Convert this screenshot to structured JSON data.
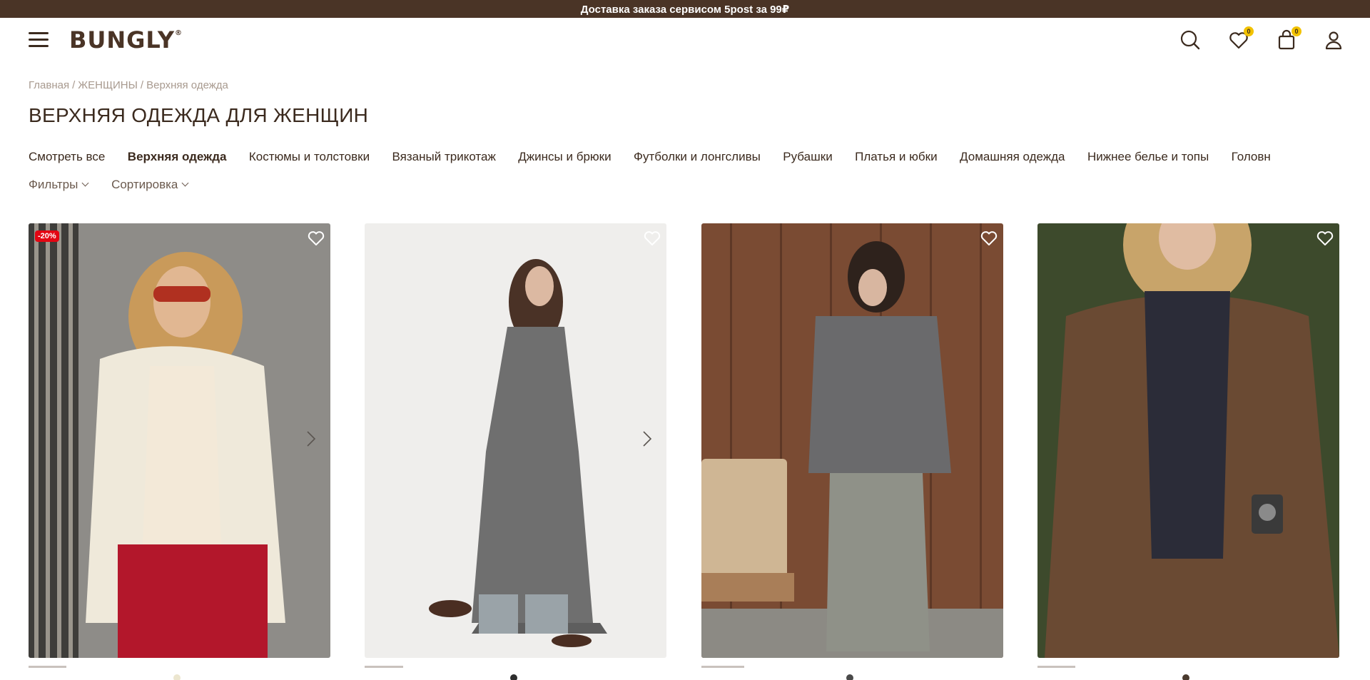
{
  "promo": {
    "text": "Доставка заказа сервисом 5post за 99₽"
  },
  "header": {
    "logo": "BUNGLY",
    "logo_mark": "®",
    "wishlist_count": "0",
    "cart_count": "0",
    "icons": [
      "menu-icon",
      "search-icon",
      "heart-icon",
      "bag-icon",
      "user-icon"
    ]
  },
  "breadcrumb": {
    "items": [
      "Главная",
      "ЖЕНЩИНЫ",
      "Верхняя одежда"
    ],
    "separator": "/"
  },
  "page_title": "ВЕРХНЯЯ ОДЕЖДА ДЛЯ ЖЕНЩИН",
  "categories": [
    {
      "label": "Смотреть все",
      "active": false
    },
    {
      "label": "Верхняя одежда",
      "active": true
    },
    {
      "label": "Костюмы и толстовки",
      "active": false
    },
    {
      "label": "Вязаный трикотаж",
      "active": false
    },
    {
      "label": "Джинсы и брюки",
      "active": false
    },
    {
      "label": "Футболки и лонгсливы",
      "active": false
    },
    {
      "label": "Рубашки",
      "active": false
    },
    {
      "label": "Платья и юбки",
      "active": false
    },
    {
      "label": "Домашняя одежда",
      "active": false
    },
    {
      "label": "Нижнее белье и топы",
      "active": false
    },
    {
      "label": "Головн",
      "active": false
    }
  ],
  "controls": {
    "filters": "Фильтры",
    "sort": "Сортировка"
  },
  "products": [
    {
      "badge": "-20%",
      "has_next_arrow": true,
      "swatch": "#ece6cf"
    },
    {
      "badge": "",
      "has_next_arrow": true,
      "swatch": "#2d2d2d"
    },
    {
      "badge": "",
      "has_next_arrow": false,
      "swatch": "#4a4a4a"
    },
    {
      "badge": "",
      "has_next_arrow": false,
      "swatch": "#4a3a2e"
    }
  ],
  "colors": {
    "brand": "#4a3426",
    "accent_badge": "#f2c200",
    "discount": "#e30613"
  }
}
